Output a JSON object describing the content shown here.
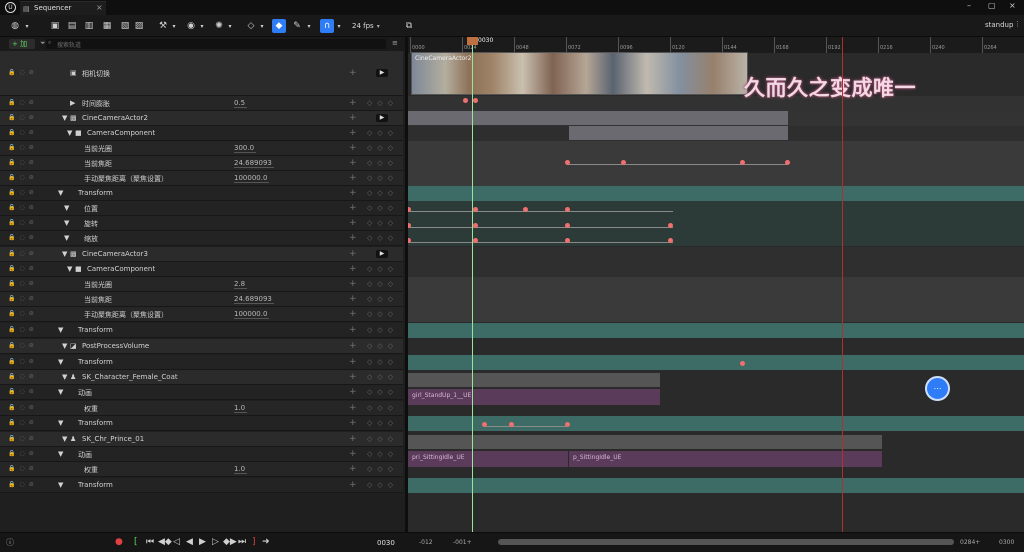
{
  "window": {
    "app_logo": "unreal-logo",
    "tab_title": "Sequencer",
    "sequence_name": "standup"
  },
  "toolbar": {
    "fps_label": "24 fps"
  },
  "outliner": {
    "add_label": "+ 加",
    "search_placeholder": "搜索轨道",
    "rows": [
      {
        "label": "相机切换"
      },
      {
        "label": "时间膨胀",
        "value": "0.5"
      },
      {
        "label": "CineCameraActor2"
      },
      {
        "label": "CameraComponent"
      },
      {
        "label": "当前光圈",
        "value": "300.0"
      },
      {
        "label": "当前焦距",
        "value": "24.689093"
      },
      {
        "label": "手动聚焦距离（聚焦设置）",
        "value": "100000.0"
      },
      {
        "label": "Transform"
      },
      {
        "label": "位置"
      },
      {
        "label": "旋转"
      },
      {
        "label": "缩放"
      },
      {
        "label": "CineCameraActor3"
      },
      {
        "label": "CameraComponent"
      },
      {
        "label": "当前光圈",
        "value": "2.8"
      },
      {
        "label": "当前焦距",
        "value": "24.689093"
      },
      {
        "label": "手动聚焦距离（聚焦设置）",
        "value": "100000.0"
      },
      {
        "label": "Transform"
      },
      {
        "label": "PostProcessVolume"
      },
      {
        "label": "Transform"
      },
      {
        "label": "SK_Character_Female_Coat"
      },
      {
        "label": "动画"
      },
      {
        "label": "权重",
        "value": "1.0"
      },
      {
        "label": "Transform"
      },
      {
        "label": "SK_Chr_Prince_01"
      },
      {
        "label": "动画"
      },
      {
        "label": "权重",
        "value": "1.0"
      },
      {
        "label": "Transform"
      }
    ]
  },
  "timeline": {
    "playhead_frame": "0030",
    "ruler_ticks": [
      "0000",
      "0024",
      "0048",
      "0072",
      "0096",
      "0120",
      "0144",
      "0168",
      "0192",
      "0216",
      "0240",
      "0264"
    ],
    "camera_section_label": "CineCameraActor2",
    "overlay_caption": "久而久之变成唯一",
    "anim_clips": [
      {
        "label": "girl_StandUp_1__UE"
      },
      {
        "label": "pri_SittingIdle_UE"
      },
      {
        "label": "p_SittingIdle_UE"
      }
    ]
  },
  "transport": {
    "current_time": "0030",
    "range_start": "-012",
    "range_mid": "-001+",
    "range_end_a": "0284+",
    "range_end_b": "0300"
  },
  "colors": {
    "playhead": "#9be39b",
    "end_marker": "#b03030",
    "key": "#f07070",
    "transform_track": "#3d6b66",
    "anim_clip": "#5e3b5e",
    "camera_bar": "#6a6a70",
    "accent_blue": "#2e7cf6"
  }
}
